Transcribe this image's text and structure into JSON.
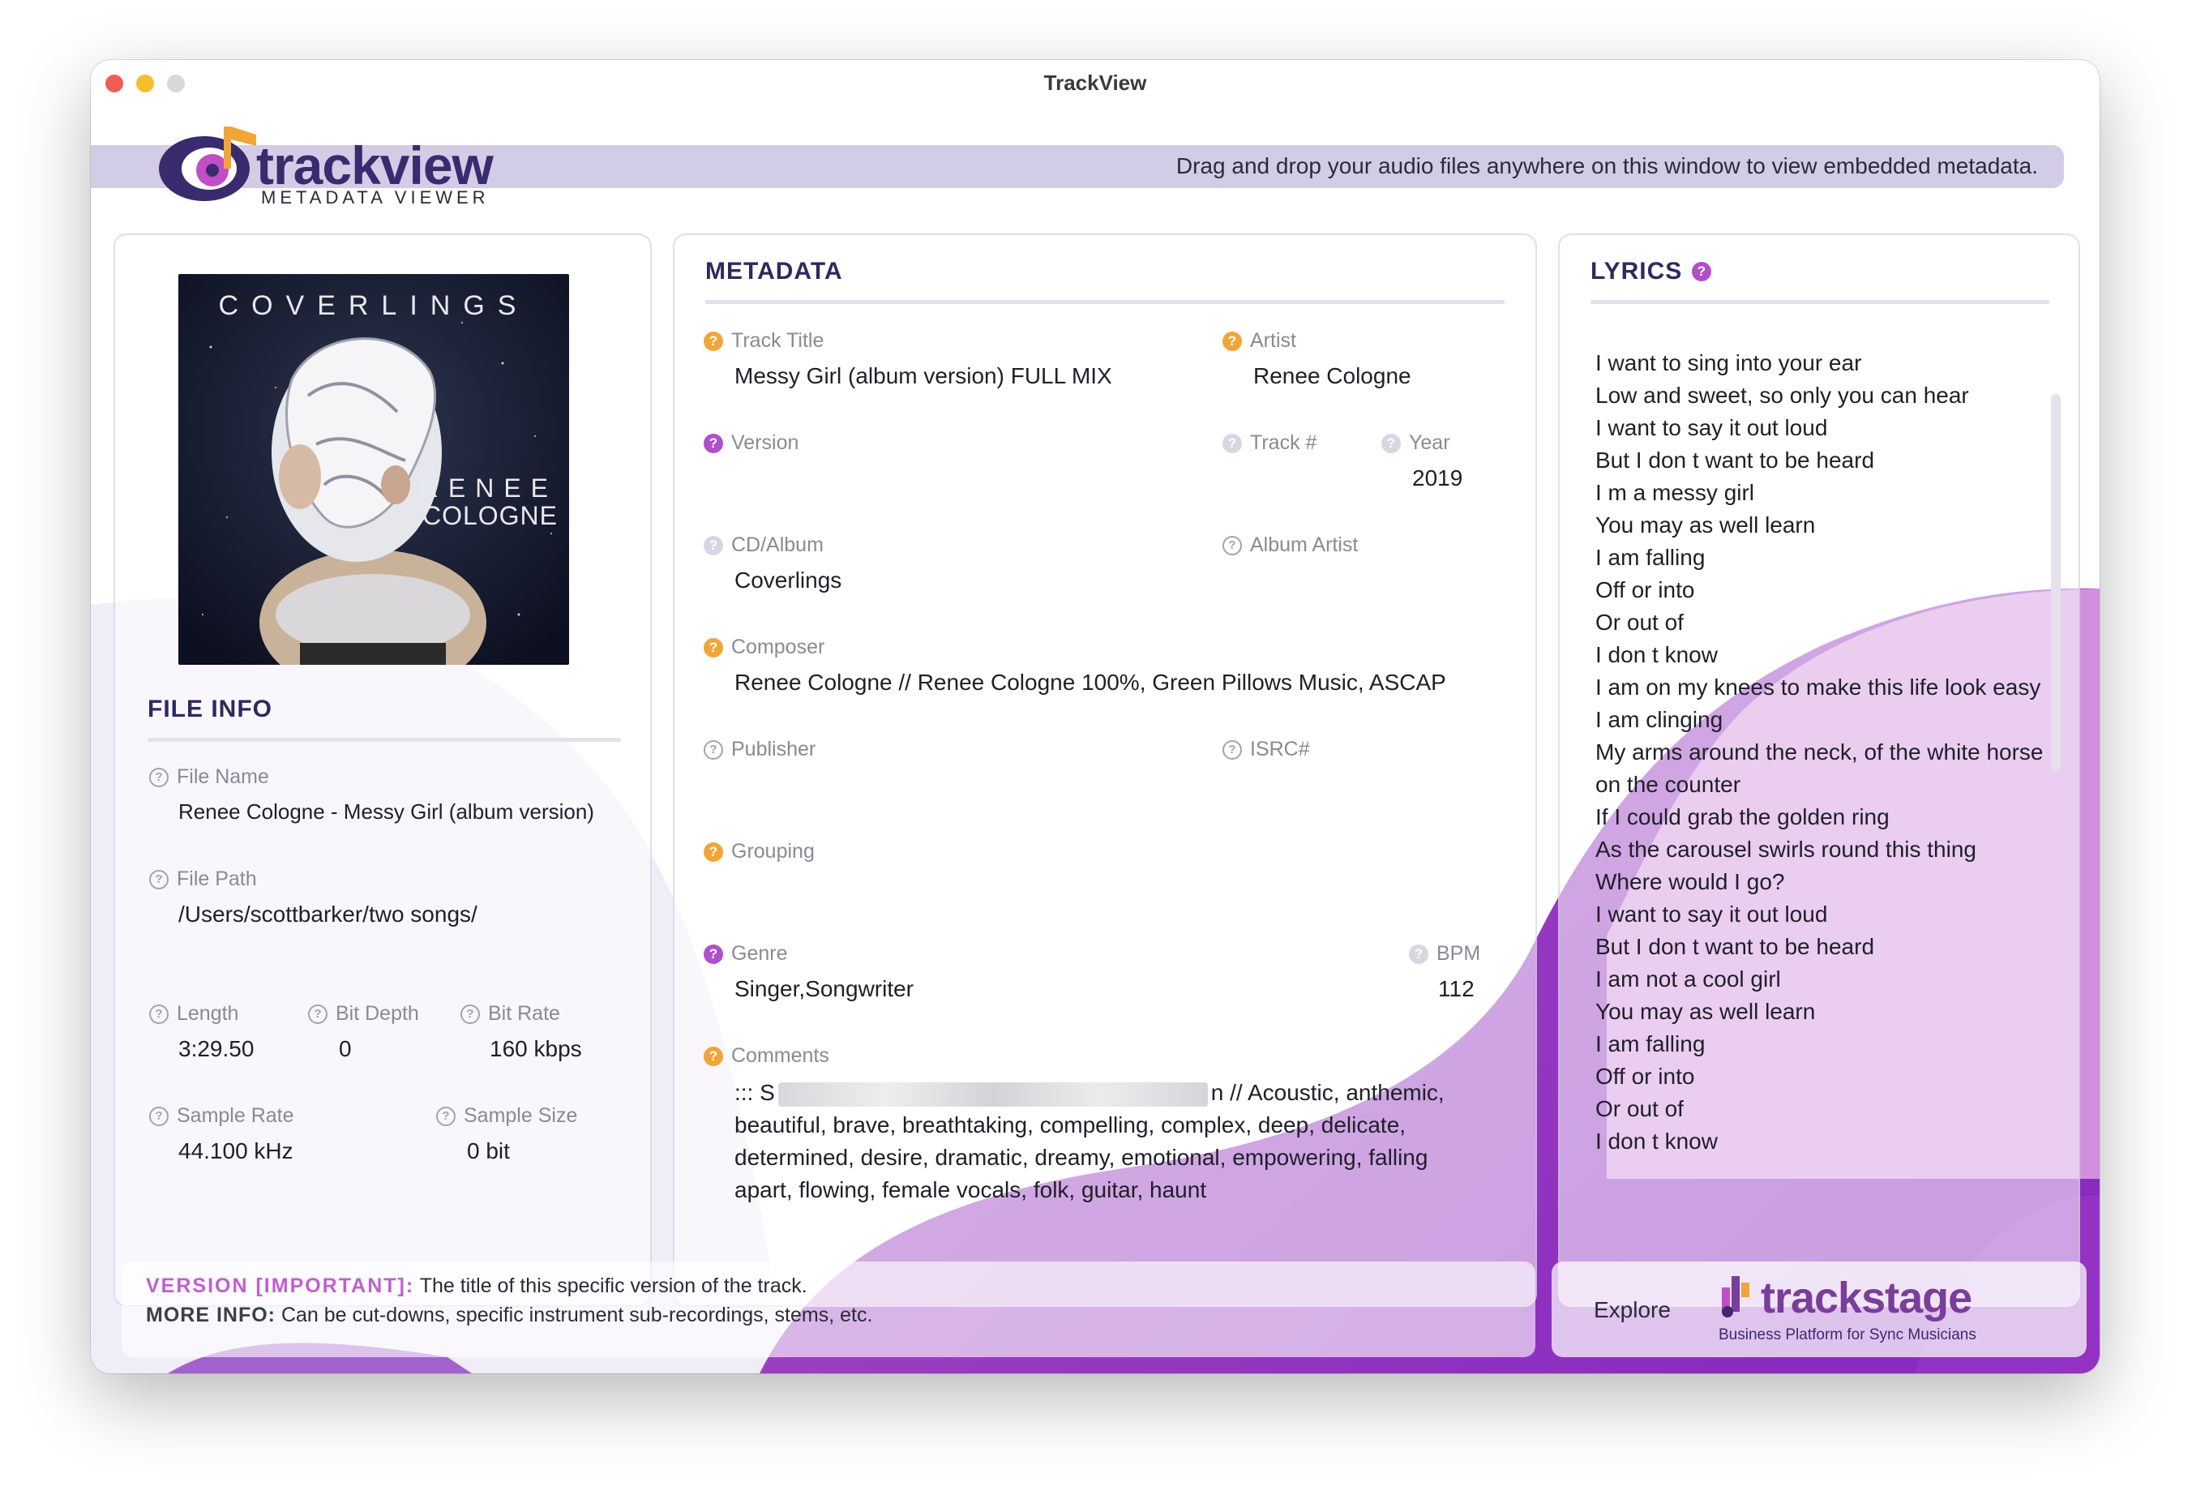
{
  "window": {
    "title": "TrackView",
    "controls": {
      "close_color": "#ee5e56",
      "minimize_color": "#f5bd2f",
      "zoom_color": "#d8d8d8"
    }
  },
  "header": {
    "logo_text": "trackview",
    "logo_subtitle": "METADATA VIEWER",
    "hint": "Drag and drop your audio files anywhere on this window to view embedded metadata."
  },
  "album_art": {
    "band": "COVERLINGS",
    "artist_line1": "RENEE",
    "artist_line2": "COLOGNE"
  },
  "file_info": {
    "title": "FILE INFO",
    "file_name": {
      "label": "File Name",
      "value": "Renee Cologne - Messy Girl (album version)"
    },
    "file_path": {
      "label": "File Path",
      "value": "/Users/scottbarker/two songs/"
    },
    "length": {
      "label": "Length",
      "value": "3:29.50"
    },
    "bit_depth": {
      "label": "Bit Depth",
      "value": "0"
    },
    "bit_rate": {
      "label": "Bit Rate",
      "value": "160 kbps"
    },
    "sample_rate": {
      "label": "Sample Rate",
      "value": "44.100 kHz"
    },
    "sample_size": {
      "label": "Sample Size",
      "value": "0 bit"
    }
  },
  "metadata": {
    "title": "METADATA",
    "track_title": {
      "label": "Track Title",
      "value": "Messy Girl (album version) FULL MIX"
    },
    "artist": {
      "label": "Artist",
      "value": "Renee Cologne"
    },
    "version": {
      "label": "Version",
      "value": ""
    },
    "track_number": {
      "label": "Track #",
      "value": ""
    },
    "year": {
      "label": "Year",
      "value": "2019"
    },
    "album": {
      "label": "CD/Album",
      "value": "Coverlings"
    },
    "album_artist": {
      "label": "Album Artist",
      "value": ""
    },
    "composer": {
      "label": "Composer",
      "value": "Renee Cologne // Renee Cologne 100%, Green Pillows Music, ASCAP"
    },
    "publisher": {
      "label": "Publisher",
      "value": ""
    },
    "isrc": {
      "label": "ISRC#",
      "value": ""
    },
    "grouping": {
      "label": "Grouping",
      "value": ""
    },
    "genre": {
      "label": "Genre",
      "value": "Singer,Songwriter"
    },
    "bpm": {
      "label": "BPM",
      "value": "112"
    },
    "comments": {
      "label": "Comments",
      "prefix": "::: S",
      "suffix": "n // Acoustic, anthemic,",
      "rest": "beautiful, brave, breathtaking, compelling, complex, deep, delicate,\ndetermined, desire, dramatic, dreamy, emotional, empowering, falling\napart, flowing, female vocals, folk, guitar, haunt"
    }
  },
  "lyrics": {
    "title": "LYRICS",
    "lines": [
      "I want to sing into your ear",
      "Low and sweet, so only you can hear",
      "I want to say it out loud",
      "But I don t want to be heard",
      "I m a messy girl",
      "You may as well learn",
      "I am falling",
      "Off or into",
      "Or out of",
      "I don t know",
      "I am on my knees to make this life look easy",
      "I am clinging",
      "My arms around the neck, of the white horse on the counter",
      "If I could grab the golden ring",
      "As the carousel swirls round this thing",
      "Where would I go?",
      "I want to say it out loud",
      "But I don t want to be heard",
      "I am not a cool girl",
      "You may as well learn",
      "I am falling",
      "Off or into",
      "Or out of",
      "I don t know"
    ]
  },
  "footer": {
    "info_key": "VERSION [IMPORTANT]:",
    "info_text": "The title of this specific version of the track.",
    "more_key": "MORE INFO:",
    "more_text": "Can be cut-downs, specific instrument sub-recordings, stems, etc.",
    "explore_label": "Explore",
    "trackstage_name": "trackstage",
    "trackstage_tagline": "Business Platform for Sync Musicians"
  },
  "colors": {
    "accent_purple": "#7b2cb8",
    "help_orange": "#f2a537",
    "help_purple": "#b04fcb",
    "heading": "#2d2a5e"
  }
}
